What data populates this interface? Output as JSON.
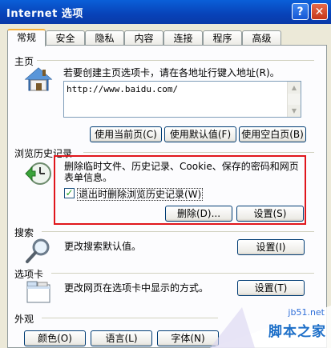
{
  "window": {
    "title": "Internet 选项",
    "help_label": "?",
    "close_label": "✕"
  },
  "tabs": [
    "常规",
    "安全",
    "隐私",
    "内容",
    "连接",
    "程序",
    "高级"
  ],
  "homepage": {
    "group_label": "主页",
    "instruction": "若要创建主页选项卡，请在各地址行键入地址(R)。",
    "url_value": "http://www.baidu.com/",
    "buttons": {
      "use_current": "使用当前页(C)",
      "use_default": "使用默认值(F)",
      "use_blank": "使用空白页(B)"
    }
  },
  "history": {
    "group_label": "浏览历史记录",
    "description_line1": "删除临时文件、历史记录、Cookie、保存的密码和网页",
    "description_line2": "表单信息。",
    "checkbox_label": "退出时删除浏览历史记录(W)",
    "checkbox_checked": true,
    "delete_button": "删除(D)...",
    "settings_button": "设置(S)",
    "highlight_color": "#e0161c"
  },
  "search": {
    "group_label": "搜索",
    "description": "更改搜索默认值。",
    "settings_button": "设置(I)"
  },
  "tabs_section": {
    "group_label": "选项卡",
    "description": "更改网页在选项卡中显示的方式。",
    "settings_button": "设置(T)"
  },
  "appearance": {
    "group_label": "外观",
    "buttons": [
      "颜色(O)",
      "语言(L)",
      "字体(N)"
    ]
  },
  "watermark": {
    "url": "jb51.net",
    "text": "脚本之家"
  },
  "icons": {
    "home": "house-icon",
    "history": "clock-arrow-icon",
    "search": "magnifier-icon",
    "tabs": "tab-window-icon"
  }
}
